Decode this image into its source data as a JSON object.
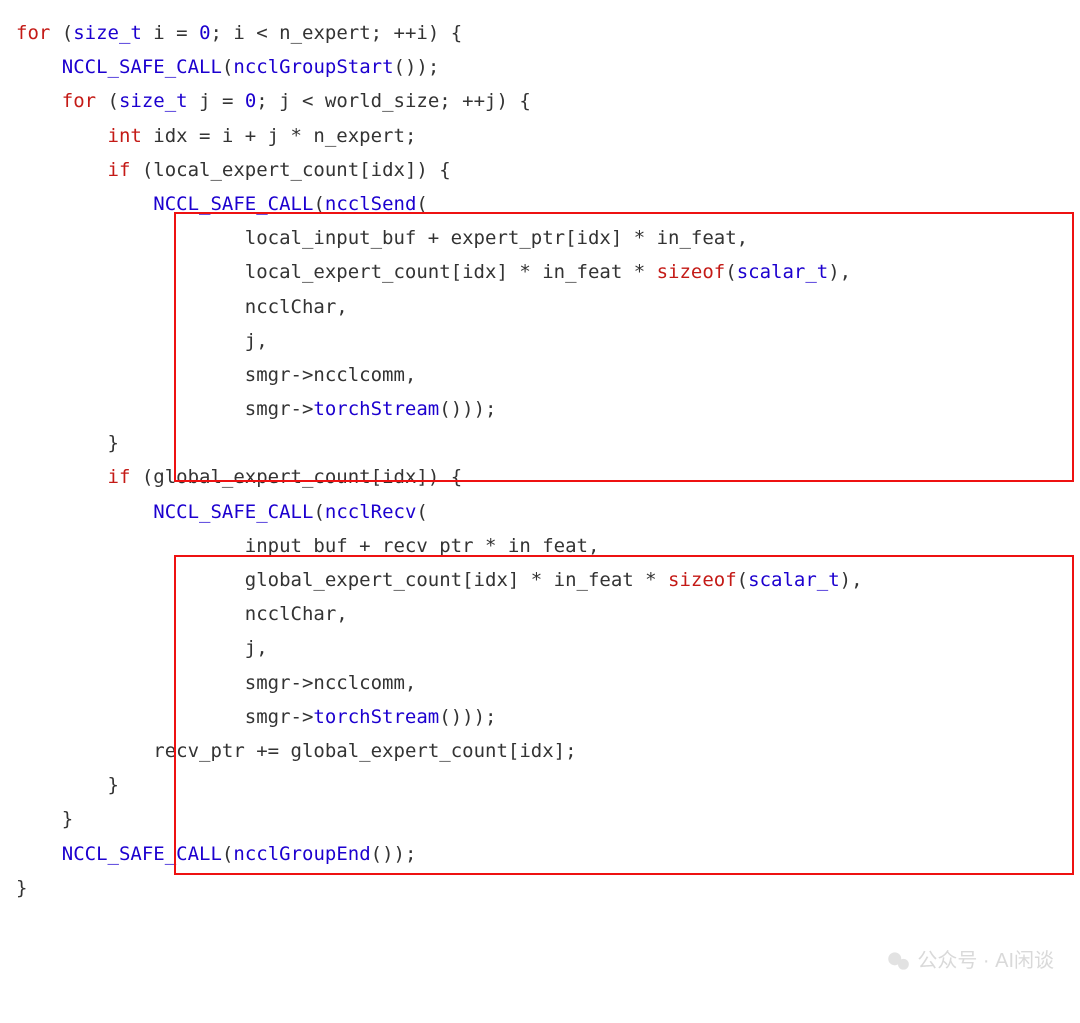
{
  "code": {
    "line01": {
      "for": "for",
      "t": "size_t",
      "a": " i = ",
      "z": "0",
      "b": "; i < n_expert; ++i) {"
    },
    "line02": {
      "call": "NCCL_SAFE_CALL",
      "fn": "ncclGroupStart",
      "rest": "());"
    },
    "line03": {
      "for": "for",
      "t": "size_t",
      "a": " j = ",
      "z": "0",
      "b": "; j < world_size; ++j) {"
    },
    "line04": {
      "kw": "int",
      "rest": " idx = i + j * n_expert;"
    },
    "line05": {
      "kw": "if",
      "rest": " (local_expert_count[idx]) {"
    },
    "line06": {
      "call": "NCCL_SAFE_CALL",
      "fn": "ncclSend",
      "rest": "("
    },
    "line07": "local_input_buf + expert_ptr[idx] * in_feat,",
    "line08": {
      "a": "local_expert_count[idx] * in_feat * ",
      "sz": "sizeof",
      "b": "(",
      "t": "scalar_t",
      "c": "),"
    },
    "line09": "ncclChar,",
    "line10": "j,",
    "line11": "smgr->ncclcomm,",
    "line12": {
      "a": "smgr->",
      "fn": "torchStream",
      "b": "()));"
    },
    "line13": "}",
    "line14": {
      "kw": "if",
      "rest": " (global_expert_count[idx]) {"
    },
    "line15": {
      "call": "NCCL_SAFE_CALL",
      "fn": "ncclRecv",
      "rest": "("
    },
    "line16": "input_buf + recv_ptr * in_feat,",
    "line17": {
      "a": "global_expert_count[idx] * in_feat * ",
      "sz": "sizeof",
      "b": "(",
      "t": "scalar_t",
      "c": "),"
    },
    "line18": "ncclChar,",
    "line19": "j,",
    "line20": "smgr->ncclcomm,",
    "line21": {
      "a": "smgr->",
      "fn": "torchStream",
      "b": "()));"
    },
    "line22": "recv_ptr += global_expert_count[idx];",
    "line23": "}",
    "line24": "}",
    "line25": {
      "call": "NCCL_SAFE_CALL",
      "fn": "ncclGroupEnd",
      "rest": "());"
    },
    "line26": "}"
  },
  "watermark": "公众号 · AI闲谈",
  "colors": {
    "keyword": "#c41a16",
    "identifier": "#1c00cf",
    "text": "#333333",
    "box": "#e11"
  }
}
